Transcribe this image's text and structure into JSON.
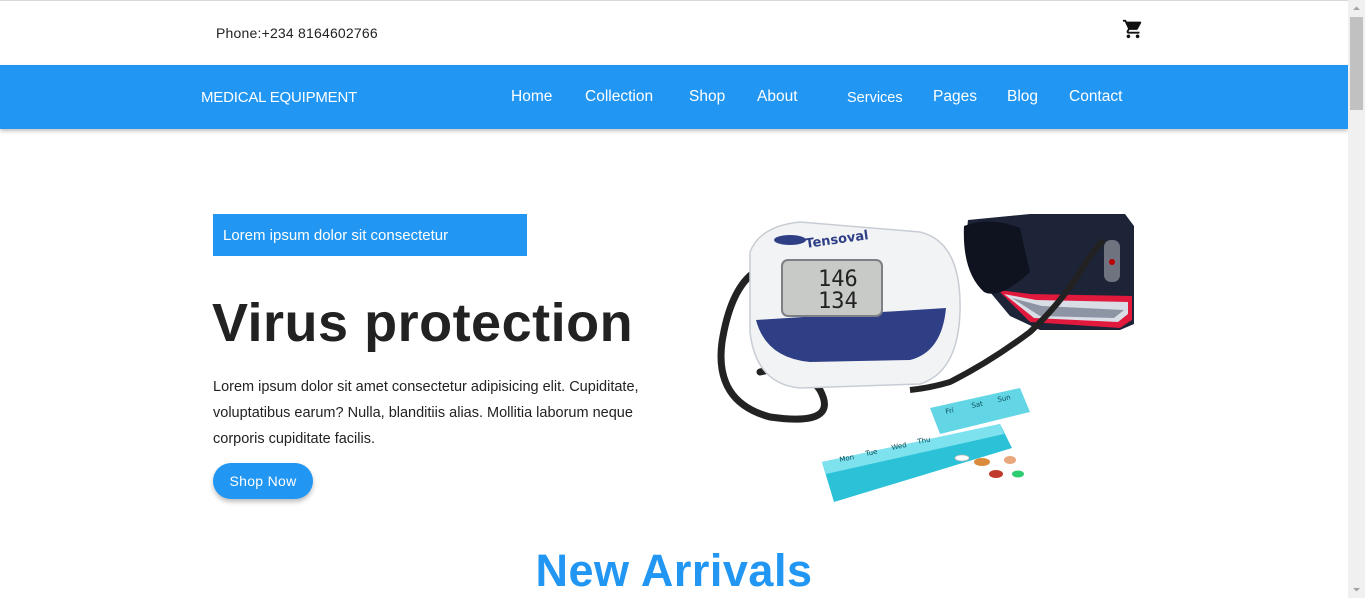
{
  "topbar": {
    "phone": "Phone:+234 8164602766",
    "cart_icon": "shopping-cart-icon"
  },
  "navbar": {
    "brand": "MEDICAL EQUIPMENT",
    "links": [
      "Home",
      "Collection",
      "Shop",
      "About",
      "Services",
      "Pages",
      "Blog",
      "Contact"
    ]
  },
  "hero": {
    "badge": "Lorem ipsum dolor sit consectetur",
    "title": "Virus protection",
    "text": "Lorem ipsum dolor sit amet consectetur adipisicing elit. Cupiditate, voluptatibus earum? Nulla, blanditiis alias. Mollitia laborum neque corporis cupiditate facilis.",
    "button": "Shop Now",
    "image": {
      "brand_text": "Tensoval",
      "reading_top": "146",
      "reading_bottom": "134",
      "pill_days": [
        "Mon",
        "Tue",
        "Wed",
        "Thu",
        "Fri",
        "Sat",
        "Sun"
      ]
    }
  },
  "sections": {
    "new_arrivals": "New Arrivals"
  },
  "colors": {
    "accent": "#2196f3",
    "text": "#222222"
  }
}
